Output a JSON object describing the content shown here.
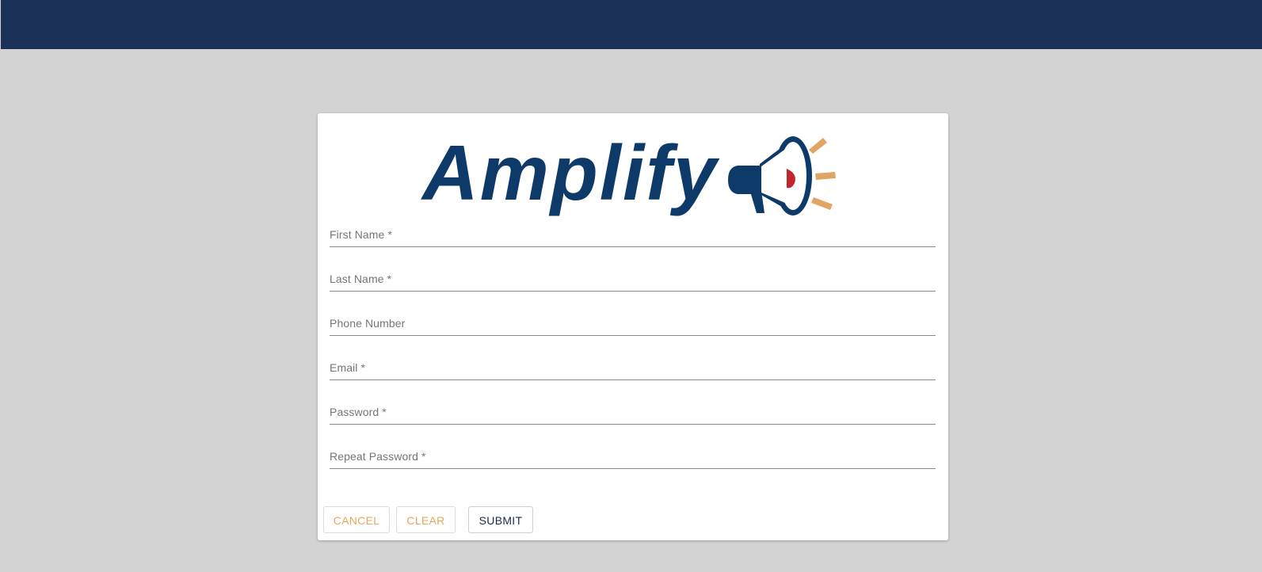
{
  "logo": {
    "text": "Amplify",
    "colors": {
      "primary": "#0d3a68",
      "accent": "#e0a464",
      "red": "#c0262c"
    },
    "icon": "megaphone-icon"
  },
  "form": {
    "fields": [
      {
        "label": "First Name *",
        "value": ""
      },
      {
        "label": "Last Name *",
        "value": ""
      },
      {
        "label": "Phone Number",
        "value": ""
      },
      {
        "label": "Email *",
        "value": ""
      },
      {
        "label": "Password *",
        "value": ""
      },
      {
        "label": "Repeat Password *",
        "value": ""
      }
    ],
    "buttons": {
      "cancel": "CANCEL",
      "clear": "CLEAR",
      "submit": "SUBMIT"
    }
  },
  "colors": {
    "header": "#1b3159",
    "background": "#d3d3d3",
    "button_secondary": "#e5a85d",
    "button_primary": "#1b2a4a"
  }
}
